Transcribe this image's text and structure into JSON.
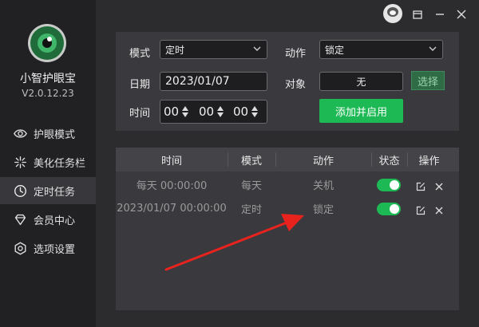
{
  "app": {
    "name": "小智护眼宝",
    "version": "V2.0.12.23"
  },
  "sidebar": {
    "items": [
      {
        "label": "护眼模式",
        "icon": "eye-icon",
        "active": false
      },
      {
        "label": "美化任务栏",
        "icon": "sparkle-icon",
        "active": false
      },
      {
        "label": "定时任务",
        "icon": "clock-icon",
        "active": true
      },
      {
        "label": "会员中心",
        "icon": "diamond-icon",
        "active": false
      },
      {
        "label": "选项设置",
        "icon": "gear-icon",
        "active": false
      }
    ]
  },
  "form": {
    "mode_label": "模式",
    "mode_value": "定时",
    "action_label": "动作",
    "action_value": "锁定",
    "date_label": "日期",
    "date_value": "2023/01/07",
    "target_label": "对象",
    "target_value": "无",
    "select_button": "选择",
    "time_label": "时间",
    "hour": "00",
    "minute": "00",
    "second": "00",
    "add_button": "添加并启用"
  },
  "table": {
    "headers": [
      "时间",
      "模式",
      "动作",
      "状态",
      "操作"
    ],
    "rows": [
      {
        "time": "每天 00:00:00",
        "mode": "每天",
        "action": "关机",
        "enabled": true
      },
      {
        "time": "2023/01/07 00:00:00",
        "mode": "定时",
        "action": "锁定",
        "enabled": true
      }
    ]
  },
  "colors": {
    "accent": "#1db954",
    "annotation": "#e8231e",
    "sidebar_bg": "#212124",
    "content_bg": "#2c2c2f"
  }
}
